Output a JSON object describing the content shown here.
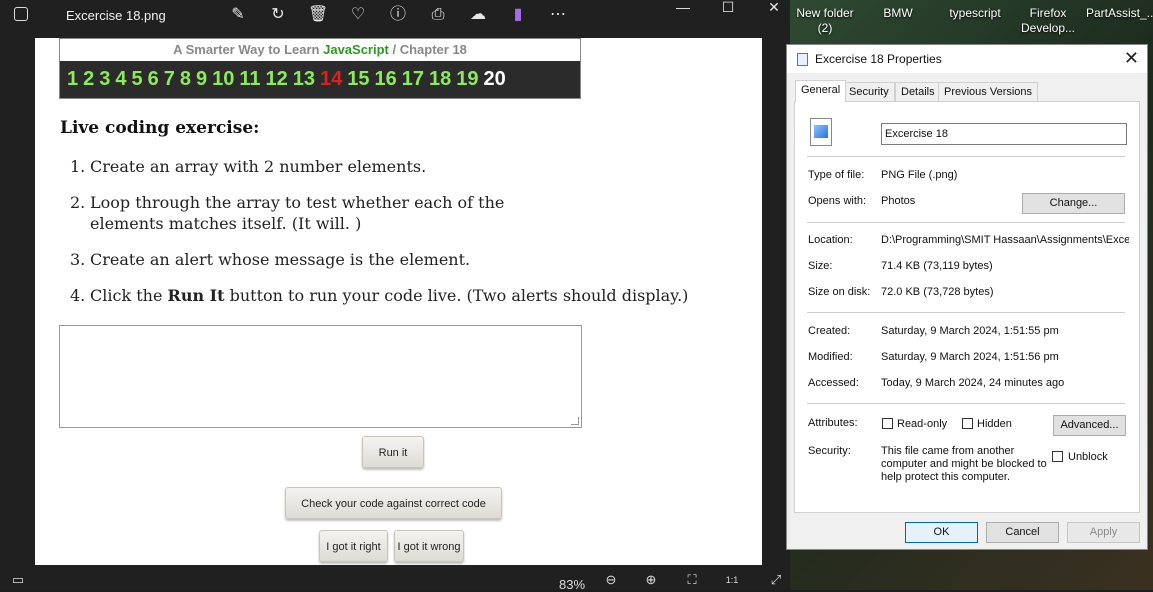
{
  "viewer": {
    "filename": "Excercise 18.png",
    "zoom": "83%",
    "window_controls": {
      "minimize": "—",
      "maximize": "☐",
      "close": "✕"
    }
  },
  "page": {
    "subtitle_prefix": "A Smarter Way to Learn ",
    "subtitle_js": "JavaScript",
    "subtitle_suffix": " / Chapter 18",
    "chapters": [
      "1",
      "2",
      "3",
      "4",
      "5",
      "6",
      "7",
      "8",
      "9",
      "10",
      "11",
      "12",
      "13",
      "14",
      "15",
      "16",
      "17",
      "18",
      "19",
      "20"
    ],
    "chapter_highlight_red": "14",
    "chapter_highlight_white": "20",
    "exercise_title": "Live coding exercise:",
    "steps": [
      {
        "n": "1.",
        "text": "Create an array with 2 number elements."
      },
      {
        "n": "2.",
        "text": "Loop through the array to test whether each of the elements matches itself. (It will. )"
      },
      {
        "n": "3.",
        "text": "Create an alert whose message is the element."
      },
      {
        "n": "4.",
        "pre": "Click the ",
        "bold": "Run It",
        "post": " button to run your code live. (Two alerts should display.)"
      }
    ],
    "run_button": "Run it",
    "check_button": "Check your code against correct code",
    "got_right_button": "I got it right",
    "got_wrong_button": "I got it wrong"
  },
  "desktop": {
    "icons": [
      "New folder (2)",
      "BMW",
      "typescript",
      "Firefox Develop...",
      "PartAssist_..."
    ]
  },
  "dialog": {
    "title": "Excercise 18 Properties",
    "tabs": [
      "General",
      "Security",
      "Details",
      "Previous Versions"
    ],
    "file_name": "Excercise 18",
    "type_label": "Type of file:",
    "type_value": "PNG File (.png)",
    "opens_label": "Opens with:",
    "opens_value": "Photos",
    "change_button": "Change...",
    "location_label": "Location:",
    "location_value": "D:\\Programming\\SMIT Hassaan\\Assignments\\Exce",
    "size_label": "Size:",
    "size_value": "71.4 KB (73,119 bytes)",
    "size_disk_label": "Size on disk:",
    "size_disk_value": "72.0 KB (73,728 bytes)",
    "created_label": "Created:",
    "created_value": "Saturday, 9 March 2024, 1:51:55 pm",
    "modified_label": "Modified:",
    "modified_value": "Saturday, 9 March 2024, 1:51:56 pm",
    "accessed_label": "Accessed:",
    "accessed_value": "Today, 9 March 2024, 24 minutes ago",
    "attributes_label": "Attributes:",
    "readonly_label": "Read-only",
    "hidden_label": "Hidden",
    "advanced_button": "Advanced...",
    "security_label": "Security:",
    "security_text": "This file came from another computer and might be blocked to help protect this computer.",
    "unblock_label": "Unblock",
    "ok_button": "OK",
    "cancel_button": "Cancel",
    "apply_button": "Apply"
  }
}
